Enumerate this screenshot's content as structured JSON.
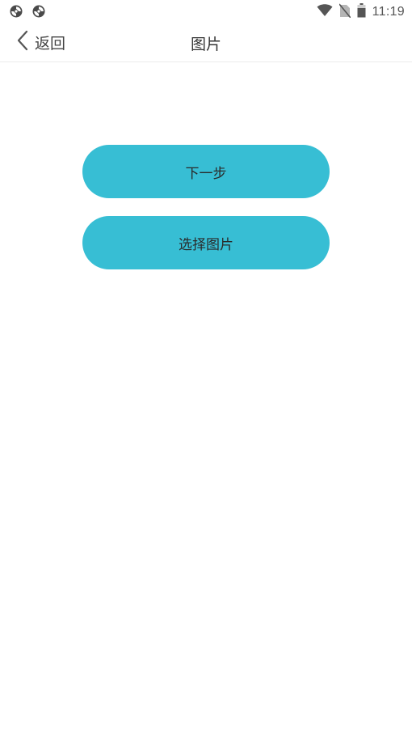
{
  "status_bar": {
    "left_icons": [
      "sync-icon",
      "sync-icon"
    ],
    "right_icons": [
      "wifi-icon",
      "no-sim-icon",
      "battery-icon"
    ],
    "time": "11:19"
  },
  "nav": {
    "back_label": "返回",
    "title": "图片"
  },
  "actions": {
    "next_label": "下一步",
    "choose_image_label": "选择图片"
  },
  "colors": {
    "accent": "#37bed4",
    "background": "#ffffff",
    "divider": "#ebebeb"
  }
}
